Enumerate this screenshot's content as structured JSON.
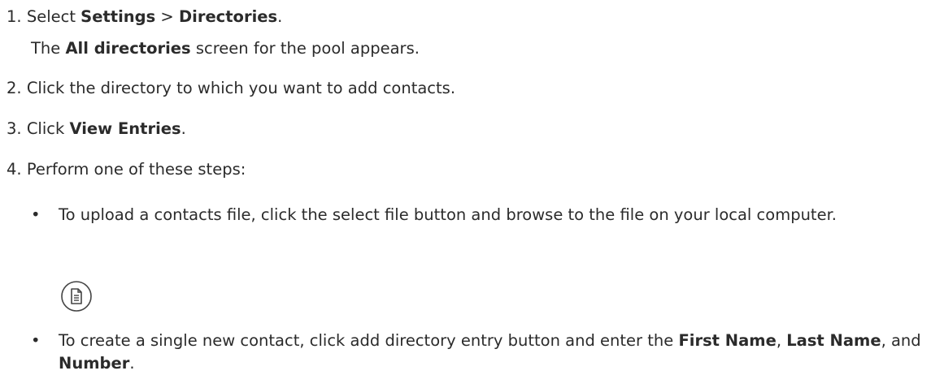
{
  "steps": [
    {
      "number": "1.",
      "prefix": "Select ",
      "bold1": "Settings",
      "sep": " > ",
      "bold2": "Directories",
      "suffix": ".",
      "result": {
        "prefix": "The ",
        "bold": "All directories",
        "suffix": " screen for the pool appears."
      }
    },
    {
      "number": "2.",
      "text": "Click the directory to which you want to add contacts."
    },
    {
      "number": "3.",
      "prefix": "Click ",
      "bold": "View Entries",
      "suffix": "."
    },
    {
      "number": "4.",
      "text": "Perform one of these steps:"
    }
  ],
  "bullets": [
    {
      "marker": "•",
      "text": "To upload a contacts file, click the select file button and browse to the file on your local computer.",
      "icon": "select-file-icon"
    },
    {
      "marker": "•",
      "prefix": "To create a single new contact, click add directory entry button and enter the ",
      "bold1": "First Name",
      "sep1": ", ",
      "bold2": "Last Name",
      "sep2": ", and ",
      "bold3": "Number",
      "suffix": "."
    }
  ]
}
